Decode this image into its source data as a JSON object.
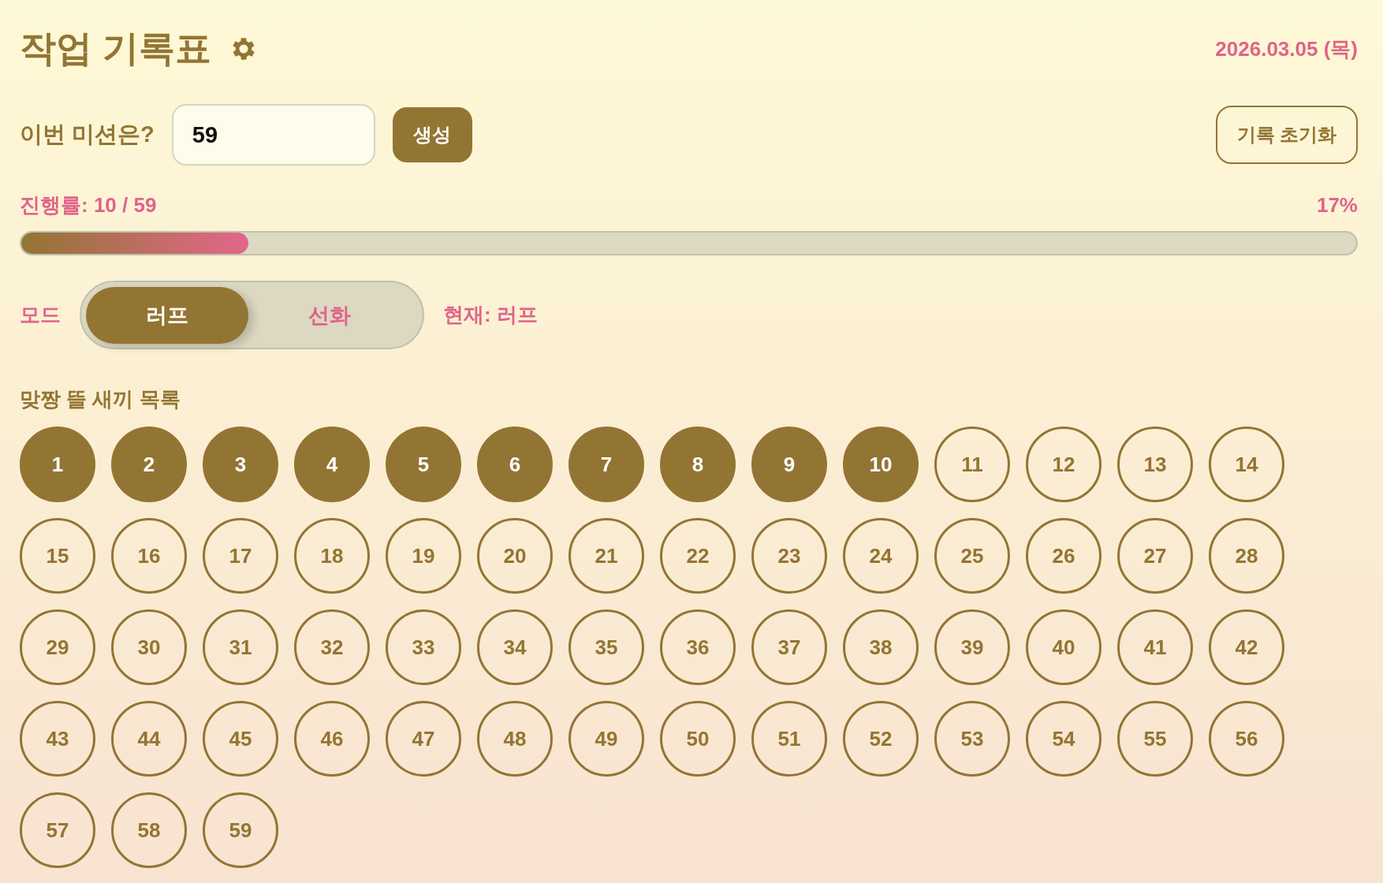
{
  "title": "작업 기록표",
  "date": "2026.03.05 (목)",
  "mission": {
    "label": "이번 미션은?",
    "value": "59",
    "generate_button": "생성"
  },
  "reset_button": "기록 초기화",
  "progress": {
    "label": "진행률: 10 / 59",
    "percent": "17%",
    "level": 0.17
  },
  "mode": {
    "label": "모드",
    "options": [
      {
        "label": "러프",
        "selected": true
      },
      {
        "label": "선화",
        "selected": false
      }
    ],
    "current": "현재: 러프"
  },
  "list": {
    "title": "맞짱 뜰 새끼 목록",
    "items": [
      {
        "label": "1",
        "done": true
      },
      {
        "label": "2",
        "done": true
      },
      {
        "label": "3",
        "done": true
      },
      {
        "label": "4",
        "done": true
      },
      {
        "label": "5",
        "done": true
      },
      {
        "label": "6",
        "done": true
      },
      {
        "label": "7",
        "done": true
      },
      {
        "label": "8",
        "done": true
      },
      {
        "label": "9",
        "done": true
      },
      {
        "label": "10",
        "done": true
      },
      {
        "label": "11",
        "done": false
      },
      {
        "label": "12",
        "done": false
      },
      {
        "label": "13",
        "done": false
      },
      {
        "label": "14",
        "done": false
      },
      {
        "label": "15",
        "done": false
      },
      {
        "label": "16",
        "done": false
      },
      {
        "label": "17",
        "done": false
      },
      {
        "label": "18",
        "done": false
      },
      {
        "label": "19",
        "done": false
      },
      {
        "label": "20",
        "done": false
      },
      {
        "label": "21",
        "done": false
      },
      {
        "label": "22",
        "done": false
      },
      {
        "label": "23",
        "done": false
      },
      {
        "label": "24",
        "done": false
      },
      {
        "label": "25",
        "done": false
      },
      {
        "label": "26",
        "done": false
      },
      {
        "label": "27",
        "done": false
      },
      {
        "label": "28",
        "done": false
      },
      {
        "label": "29",
        "done": false
      },
      {
        "label": "30",
        "done": false
      },
      {
        "label": "31",
        "done": false
      },
      {
        "label": "32",
        "done": false
      },
      {
        "label": "33",
        "done": false
      },
      {
        "label": "34",
        "done": false
      },
      {
        "label": "35",
        "done": false
      },
      {
        "label": "36",
        "done": false
      },
      {
        "label": "37",
        "done": false
      },
      {
        "label": "38",
        "done": false
      },
      {
        "label": "39",
        "done": false
      },
      {
        "label": "40",
        "done": false
      },
      {
        "label": "41",
        "done": false
      },
      {
        "label": "42",
        "done": false
      },
      {
        "label": "43",
        "done": false
      },
      {
        "label": "44",
        "done": false
      },
      {
        "label": "45",
        "done": false
      },
      {
        "label": "46",
        "done": false
      },
      {
        "label": "47",
        "done": false
      },
      {
        "label": "48",
        "done": false
      },
      {
        "label": "49",
        "done": false
      },
      {
        "label": "50",
        "done": false
      },
      {
        "label": "51",
        "done": false
      },
      {
        "label": "52",
        "done": false
      },
      {
        "label": "53",
        "done": false
      },
      {
        "label": "54",
        "done": false
      },
      {
        "label": "55",
        "done": false
      },
      {
        "label": "56",
        "done": false
      },
      {
        "label": "57",
        "done": false
      },
      {
        "label": "58",
        "done": false
      },
      {
        "label": "59",
        "done": false
      }
    ]
  }
}
